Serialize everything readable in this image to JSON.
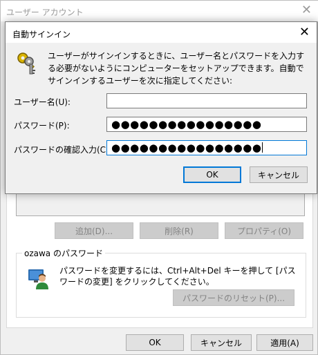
{
  "background_window": {
    "title": "ユーザー アカウント",
    "close_glyph": "✕",
    "buttons": {
      "add": "追加(D)...",
      "remove": "削除(R)",
      "properties": "プロパティ(O)"
    },
    "password_group": {
      "title": "ozawa のパスワード",
      "text": "パスワードを変更するには、Ctrl+Alt+Del キーを押して [パスワードの変更] をクリックしてください。",
      "reset_button": "パスワードのリセット(P)..."
    },
    "footer": {
      "ok": "OK",
      "cancel": "キャンセル",
      "apply": "適用(A)"
    }
  },
  "dialog": {
    "title": "自動サインイン",
    "close_glyph": "✕",
    "description": "ユーザーがサインインするときに、ユーザー名とパスワードを入力する必要がないようにコンピューターをセットアップできます。自動でサインインするユーザーを次に指定してください:",
    "fields": {
      "username_label": "ユーザー名(U):",
      "username_value": "",
      "password_label": "パスワード(P):",
      "password_value": "●●●●●●●●●●●●●●●●",
      "confirm_label": "パスワードの確認入力(C):",
      "confirm_value": "●●●●●●●●●●●●●●●●"
    },
    "buttons": {
      "ok": "OK",
      "cancel": "キャンセル"
    }
  },
  "icons": {
    "keys": "keys-icon",
    "users": "users-icon"
  },
  "colors": {
    "accent": "#0078d7",
    "window_bg": "#f0f0f0"
  }
}
